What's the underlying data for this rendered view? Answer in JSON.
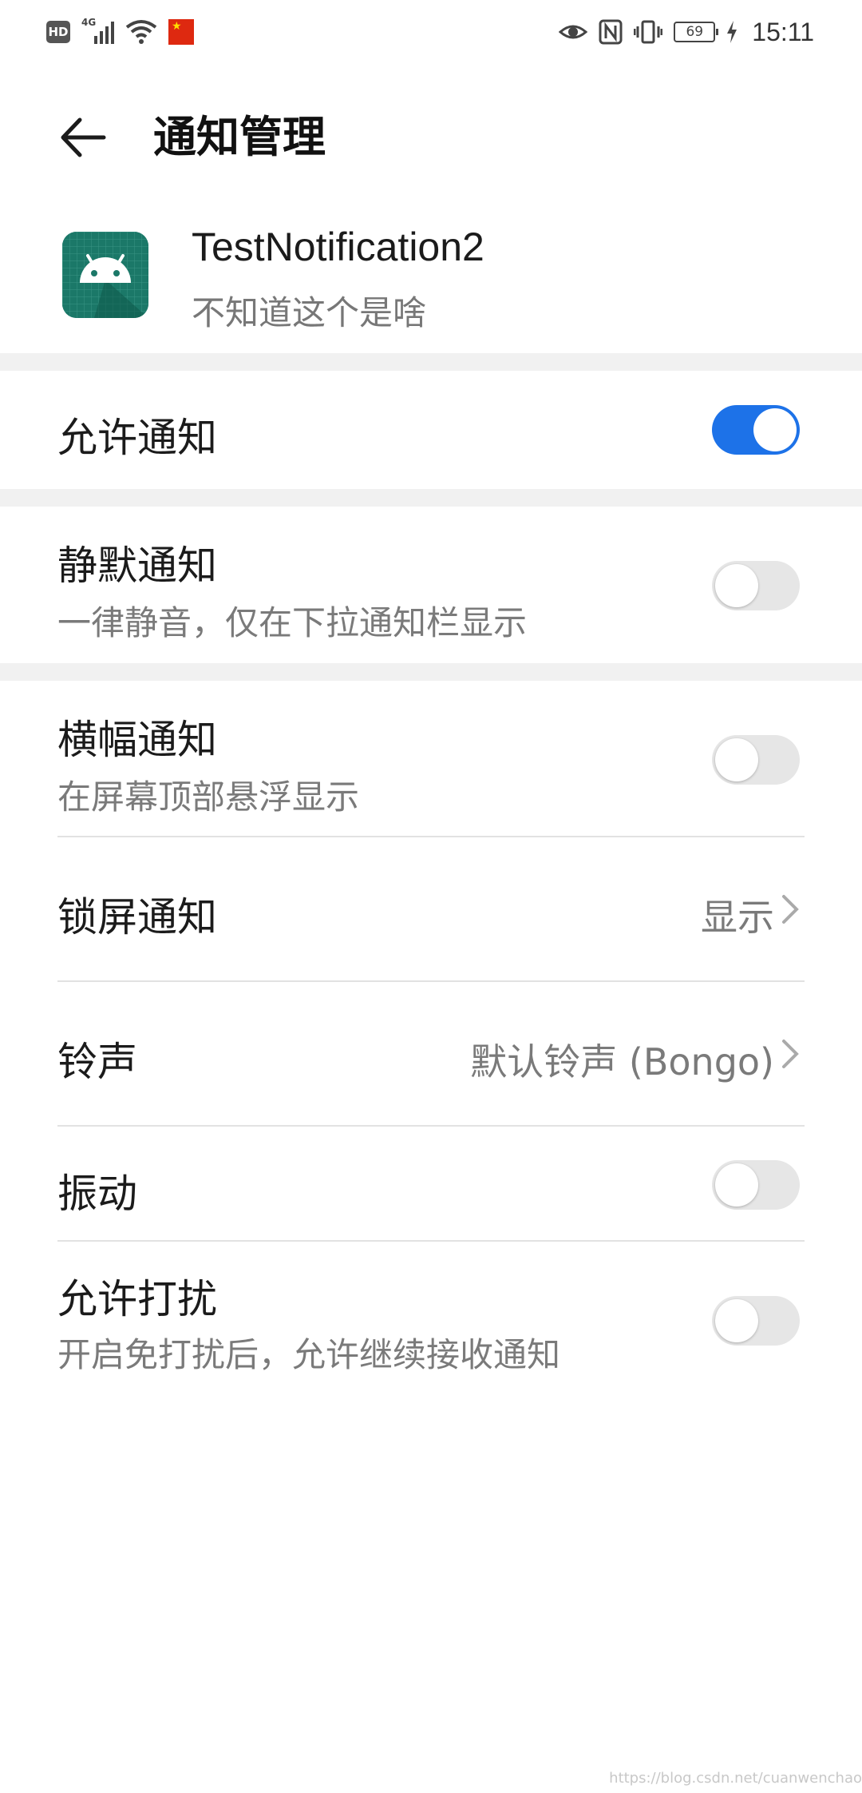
{
  "status_bar": {
    "hd": "HD",
    "network": "4G",
    "battery": "69",
    "time": "15:11"
  },
  "header": {
    "title": "通知管理"
  },
  "app": {
    "name": "TestNotification2",
    "description": "不知道这个是啥"
  },
  "settings": {
    "allow_notifications": {
      "label": "允许通知",
      "enabled": true
    },
    "silent": {
      "label": "静默通知",
      "sub": "一律静音，仅在下拉通知栏显示",
      "enabled": false
    },
    "banner": {
      "label": "横幅通知",
      "sub": "在屏幕顶部悬浮显示",
      "enabled": false
    },
    "lock_screen": {
      "label": "锁屏通知",
      "value": "显示"
    },
    "ringtone": {
      "label": "铃声",
      "value": "默认铃声 (Bongo)"
    },
    "vibrate": {
      "label": "振动",
      "enabled": false
    },
    "dnd": {
      "label": "允许打扰",
      "sub": "开启免打扰后，允许继续接收通知",
      "enabled": false
    }
  },
  "colors": {
    "accent": "#1d72e8",
    "app_icon_bg": "#1b7868",
    "section_gap": "#f1f1f1"
  },
  "watermark": "https://blog.csdn.net/cuanwenchao"
}
